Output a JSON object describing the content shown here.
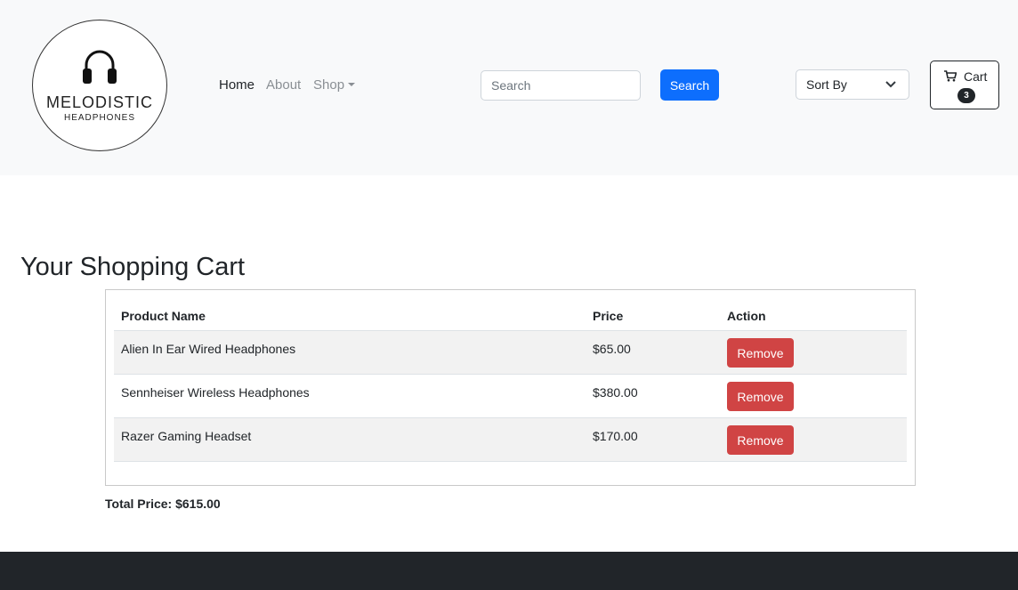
{
  "brand": {
    "name": "MELODISTIC",
    "tagline": "HEADPHONES"
  },
  "nav": {
    "home": "Home",
    "about": "About",
    "shop": "Shop"
  },
  "search": {
    "placeholder": "Search",
    "button_label": "Search"
  },
  "sort": {
    "selected": "Sort By"
  },
  "cart": {
    "label": "Cart",
    "count": "3"
  },
  "page": {
    "title": "Your Shopping Cart"
  },
  "table": {
    "headers": {
      "product": "Product Name",
      "price": "Price",
      "action": "Action"
    },
    "rows": [
      {
        "product": "Alien In Ear Wired Headphones",
        "price": "$65.00",
        "action": "Remove"
      },
      {
        "product": "Sennheiser Wireless Headphones",
        "price": "$380.00",
        "action": "Remove"
      },
      {
        "product": "Razer Gaming Headset",
        "price": "$170.00",
        "action": "Remove"
      }
    ]
  },
  "total": {
    "text": "Total Price: $615.00"
  },
  "colors": {
    "primary": "#0d6efd",
    "danger": "#d04444",
    "dark": "#212529",
    "navbar_bg": "#f8f9fa"
  },
  "icons": {
    "logo": "headphones-icon",
    "cart": "cart-icon",
    "sort": "chevron-down-icon",
    "shop": "caret-down-icon"
  }
}
